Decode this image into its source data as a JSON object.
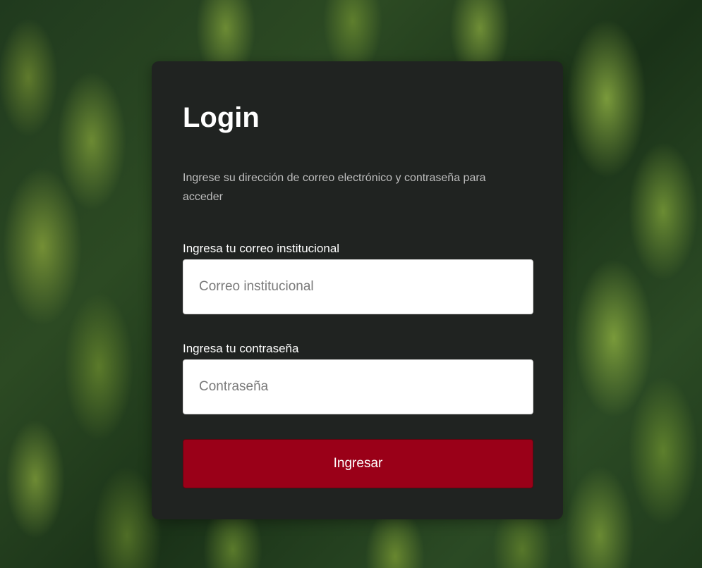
{
  "login": {
    "title": "Login",
    "subtitle": "Ingrese su dirección de correo electrónico y contraseña para acceder",
    "email_label": "Ingresa tu correo institucional",
    "email_placeholder": "Correo institucional",
    "email_value": "",
    "password_label": "Ingresa tu contraseña",
    "password_placeholder": "Contraseña",
    "password_value": "",
    "submit_label": "Ingresar"
  },
  "colors": {
    "card_background": "#202321",
    "button_background": "#9a0018",
    "text": "#ffffff",
    "subtitle_text": "#bdbdbd"
  }
}
